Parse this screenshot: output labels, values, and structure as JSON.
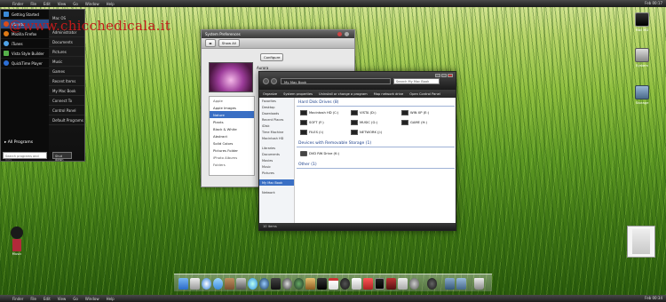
{
  "menubar_top": {
    "items": [
      "Finder",
      "File",
      "Edit",
      "View",
      "Go",
      "Window",
      "Help"
    ],
    "clock": "Feb 00:17"
  },
  "menubar_bottom": {
    "items": [
      "Finder",
      "File",
      "Edit",
      "View",
      "Go",
      "Window",
      "Help"
    ],
    "clock": "Feb 00:34"
  },
  "watermark": "@www.chicchedicala.it",
  "start_menu": {
    "left_items": [
      "Getting Started",
      "Ubuntu",
      "Mozilla Firefox",
      "iTunes",
      "Vista Style Builder",
      "QuickTime Player"
    ],
    "right_items": [
      "Mac OS",
      "Administrator",
      "Documents",
      "Pictures",
      "Music",
      "Games",
      "Recent Items",
      "My Mac Book",
      "Connect To",
      "Control Panel",
      "Default Programs"
    ],
    "all_programs": "All Programs",
    "search_placeholder": "Search programs and files",
    "shutdown": "Shut down"
  },
  "system_prefs": {
    "title": "System Preferences",
    "show_all": "Show All",
    "configure": "Configure",
    "wallpaper_name": "Aurora",
    "side_items": [
      "Apple",
      "Apple Images",
      "Nature",
      "Plants",
      "Black & White",
      "Abstract",
      "Solid Colors",
      "Pictures Folder",
      "iPhoto Albums",
      "Folders"
    ],
    "selected_index": 2
  },
  "explorer": {
    "address": "My Mac Book",
    "search_placeholder": "Search My Mac Book",
    "toolbar": [
      "Organize",
      "System properties",
      "Uninstall or change a program",
      "Map network drive",
      "Open Control Panel"
    ],
    "nav": [
      "Favorites",
      "Desktop",
      "Downloads",
      "Recent Places",
      "iDisk",
      "Time Machine",
      "Macintosh HD",
      "Libraries",
      "Documents",
      "Movies",
      "Music",
      "Pictures",
      "My Mac Book",
      "Network"
    ],
    "nav_selected_index": 12,
    "hard_disk_header": "Hard Disk Drives (8)",
    "drives": [
      "Macintosh HD (C:)",
      "VISTA (D:)",
      "WIN XP (E:)",
      "SOFT (F:)",
      "MUSIC (G:)",
      "GAME (H:)",
      "FILES (I:)",
      "NETWORK (J:)"
    ],
    "removable_header": "Devices with Removable Storage (1)",
    "removable": [
      "DVD RW Drive (K:)"
    ],
    "other_header": "Other (1)",
    "status": "10 items"
  },
  "desktop_icons": [
    {
      "label": "Mac HD"
    },
    {
      "label": "System"
    },
    {
      "label": "Storage"
    }
  ],
  "doll_label": "Music"
}
